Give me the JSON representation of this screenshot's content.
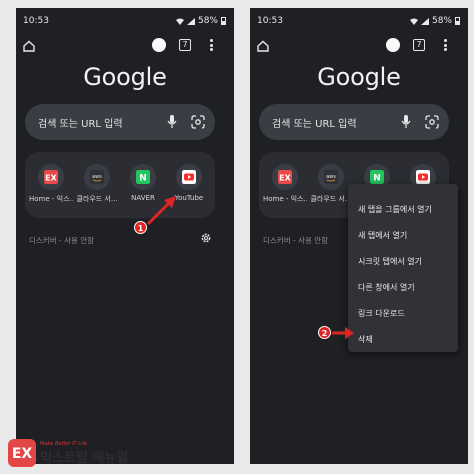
{
  "status": {
    "time": "10:53",
    "battery": "58%"
  },
  "toolbar": {
    "tab_count": "7"
  },
  "google_logo": "Google",
  "search": {
    "placeholder": "검색 또는 URL 입력"
  },
  "shortcuts": [
    {
      "label": "Home - 익스...",
      "favicon_color": "#e84a4a",
      "icon": "ex-logo-icon"
    },
    {
      "label": "클라우드 서...",
      "favicon_color": "#2f3136",
      "icon": "aws-icon",
      "text": "aws"
    },
    {
      "label": "NAVER",
      "favicon_color": "#22c55e",
      "icon": "naver-icon",
      "text": "N"
    },
    {
      "label": "YouTube",
      "favicon_color": "#ff2a2a",
      "icon": "youtube-icon"
    }
  ],
  "discover": "디스커버 - 사용 안함",
  "callouts": {
    "first": "1",
    "second": "2"
  },
  "context_menu": [
    "새 탭을 그룹에서 열기",
    "새 탭에서 열기",
    "시크릿 탭에서 열기",
    "다른 창에서 열기",
    "링크 다운로드",
    "삭제"
  ],
  "brand": {
    "tagline": "Make Better IT Life",
    "name": "익스트림 매뉴얼",
    "accent": "#e24646"
  }
}
